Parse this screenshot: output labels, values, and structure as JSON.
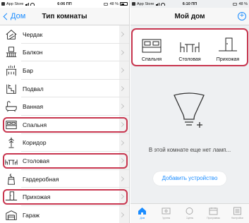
{
  "left_screen": {
    "status_bar": {
      "carrier": "App Store",
      "time": "6:06 ПП",
      "battery": "48 %"
    },
    "nav": {
      "back_label": "Дом",
      "title": "Тип комнаты"
    },
    "rooms": [
      {
        "label": "Чердак",
        "icon": "attic-icon",
        "highlighted": false
      },
      {
        "label": "Балкон",
        "icon": "balcony-icon",
        "highlighted": false
      },
      {
        "label": "Бар",
        "icon": "bar-icon",
        "highlighted": false
      },
      {
        "label": "Подвал",
        "icon": "basement-icon",
        "highlighted": false
      },
      {
        "label": "Ванная",
        "icon": "bathtub-icon",
        "highlighted": false
      },
      {
        "label": "Спальня",
        "icon": "bed-icon",
        "highlighted": true
      },
      {
        "label": "Коридор",
        "icon": "coat-rack-icon",
        "highlighted": false
      },
      {
        "label": "Столовая",
        "icon": "dining-table-icon",
        "highlighted": true
      },
      {
        "label": "Гардеробная",
        "icon": "wardrobe-icon",
        "highlighted": false
      },
      {
        "label": "Прихожая",
        "icon": "hallway-icon",
        "highlighted": true
      },
      {
        "label": "Гараж",
        "icon": "garage-icon",
        "highlighted": false
      }
    ]
  },
  "right_screen": {
    "status_bar": {
      "carrier": "App Store",
      "time": "6:10 ПП",
      "battery": "48 %"
    },
    "nav": {
      "title": "Мой дом"
    },
    "room_types": [
      {
        "label": "Спальня",
        "icon": "bed-icon"
      },
      {
        "label": "Столовая",
        "icon": "dining-table-icon"
      },
      {
        "label": "Прихожая",
        "icon": "hallway-icon"
      }
    ],
    "empty_text": "В этой комнате еще нет ламп...",
    "add_button_label": "Добавить устройство",
    "tabs": [
      {
        "label": "Дом",
        "icon": "home-tab-icon",
        "active": true
      },
      {
        "label": "Группы",
        "icon": "groups-tab-icon",
        "active": false
      },
      {
        "label": "Сцены",
        "icon": "scenes-tab-icon",
        "active": false
      },
      {
        "label": "Программы",
        "icon": "routines-tab-icon",
        "active": false
      },
      {
        "label": "Настройки",
        "icon": "settings-tab-icon",
        "active": false
      }
    ]
  },
  "colors": {
    "accent": "#1a8cff",
    "highlight": "#c8364f"
  }
}
